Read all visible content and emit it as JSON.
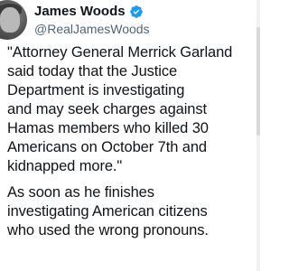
{
  "author": {
    "display_name": "James Woods",
    "handle": "@RealJamesWoods",
    "verified": true,
    "verified_color": "#1d9bf0"
  },
  "tweet": {
    "paragraph1": "\"Attorney General Merrick Garland\nsaid today that the Justice\nDepartment is investigating\nand may seek charges against\nHamas members who killed 30\nAmericans on October 7th and\nkidnapped more.\"",
    "paragraph2": "As soon as he finishes\ninvestigating American citizens\nwho used the wrong pronouns."
  },
  "colors": {
    "text_primary": "#0f1419",
    "text_secondary": "#536471",
    "background": "#ffffff"
  }
}
